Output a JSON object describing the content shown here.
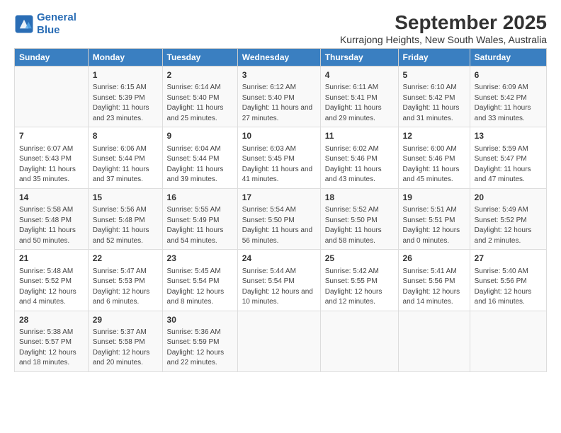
{
  "header": {
    "logo_line1": "General",
    "logo_line2": "Blue",
    "title": "September 2025",
    "subtitle": "Kurrajong Heights, New South Wales, Australia"
  },
  "days_of_week": [
    "Sunday",
    "Monday",
    "Tuesday",
    "Wednesday",
    "Thursday",
    "Friday",
    "Saturday"
  ],
  "weeks": [
    [
      {
        "day": "",
        "sunrise": "",
        "sunset": "",
        "daylight": ""
      },
      {
        "day": "1",
        "sunrise": "Sunrise: 6:15 AM",
        "sunset": "Sunset: 5:39 PM",
        "daylight": "Daylight: 11 hours and 23 minutes."
      },
      {
        "day": "2",
        "sunrise": "Sunrise: 6:14 AM",
        "sunset": "Sunset: 5:40 PM",
        "daylight": "Daylight: 11 hours and 25 minutes."
      },
      {
        "day": "3",
        "sunrise": "Sunrise: 6:12 AM",
        "sunset": "Sunset: 5:40 PM",
        "daylight": "Daylight: 11 hours and 27 minutes."
      },
      {
        "day": "4",
        "sunrise": "Sunrise: 6:11 AM",
        "sunset": "Sunset: 5:41 PM",
        "daylight": "Daylight: 11 hours and 29 minutes."
      },
      {
        "day": "5",
        "sunrise": "Sunrise: 6:10 AM",
        "sunset": "Sunset: 5:42 PM",
        "daylight": "Daylight: 11 hours and 31 minutes."
      },
      {
        "day": "6",
        "sunrise": "Sunrise: 6:09 AM",
        "sunset": "Sunset: 5:42 PM",
        "daylight": "Daylight: 11 hours and 33 minutes."
      }
    ],
    [
      {
        "day": "7",
        "sunrise": "Sunrise: 6:07 AM",
        "sunset": "Sunset: 5:43 PM",
        "daylight": "Daylight: 11 hours and 35 minutes."
      },
      {
        "day": "8",
        "sunrise": "Sunrise: 6:06 AM",
        "sunset": "Sunset: 5:44 PM",
        "daylight": "Daylight: 11 hours and 37 minutes."
      },
      {
        "day": "9",
        "sunrise": "Sunrise: 6:04 AM",
        "sunset": "Sunset: 5:44 PM",
        "daylight": "Daylight: 11 hours and 39 minutes."
      },
      {
        "day": "10",
        "sunrise": "Sunrise: 6:03 AM",
        "sunset": "Sunset: 5:45 PM",
        "daylight": "Daylight: 11 hours and 41 minutes."
      },
      {
        "day": "11",
        "sunrise": "Sunrise: 6:02 AM",
        "sunset": "Sunset: 5:46 PM",
        "daylight": "Daylight: 11 hours and 43 minutes."
      },
      {
        "day": "12",
        "sunrise": "Sunrise: 6:00 AM",
        "sunset": "Sunset: 5:46 PM",
        "daylight": "Daylight: 11 hours and 45 minutes."
      },
      {
        "day": "13",
        "sunrise": "Sunrise: 5:59 AM",
        "sunset": "Sunset: 5:47 PM",
        "daylight": "Daylight: 11 hours and 47 minutes."
      }
    ],
    [
      {
        "day": "14",
        "sunrise": "Sunrise: 5:58 AM",
        "sunset": "Sunset: 5:48 PM",
        "daylight": "Daylight: 11 hours and 50 minutes."
      },
      {
        "day": "15",
        "sunrise": "Sunrise: 5:56 AM",
        "sunset": "Sunset: 5:48 PM",
        "daylight": "Daylight: 11 hours and 52 minutes."
      },
      {
        "day": "16",
        "sunrise": "Sunrise: 5:55 AM",
        "sunset": "Sunset: 5:49 PM",
        "daylight": "Daylight: 11 hours and 54 minutes."
      },
      {
        "day": "17",
        "sunrise": "Sunrise: 5:54 AM",
        "sunset": "Sunset: 5:50 PM",
        "daylight": "Daylight: 11 hours and 56 minutes."
      },
      {
        "day": "18",
        "sunrise": "Sunrise: 5:52 AM",
        "sunset": "Sunset: 5:50 PM",
        "daylight": "Daylight: 11 hours and 58 minutes."
      },
      {
        "day": "19",
        "sunrise": "Sunrise: 5:51 AM",
        "sunset": "Sunset: 5:51 PM",
        "daylight": "Daylight: 12 hours and 0 minutes."
      },
      {
        "day": "20",
        "sunrise": "Sunrise: 5:49 AM",
        "sunset": "Sunset: 5:52 PM",
        "daylight": "Daylight: 12 hours and 2 minutes."
      }
    ],
    [
      {
        "day": "21",
        "sunrise": "Sunrise: 5:48 AM",
        "sunset": "Sunset: 5:52 PM",
        "daylight": "Daylight: 12 hours and 4 minutes."
      },
      {
        "day": "22",
        "sunrise": "Sunrise: 5:47 AM",
        "sunset": "Sunset: 5:53 PM",
        "daylight": "Daylight: 12 hours and 6 minutes."
      },
      {
        "day": "23",
        "sunrise": "Sunrise: 5:45 AM",
        "sunset": "Sunset: 5:54 PM",
        "daylight": "Daylight: 12 hours and 8 minutes."
      },
      {
        "day": "24",
        "sunrise": "Sunrise: 5:44 AM",
        "sunset": "Sunset: 5:54 PM",
        "daylight": "Daylight: 12 hours and 10 minutes."
      },
      {
        "day": "25",
        "sunrise": "Sunrise: 5:42 AM",
        "sunset": "Sunset: 5:55 PM",
        "daylight": "Daylight: 12 hours and 12 minutes."
      },
      {
        "day": "26",
        "sunrise": "Sunrise: 5:41 AM",
        "sunset": "Sunset: 5:56 PM",
        "daylight": "Daylight: 12 hours and 14 minutes."
      },
      {
        "day": "27",
        "sunrise": "Sunrise: 5:40 AM",
        "sunset": "Sunset: 5:56 PM",
        "daylight": "Daylight: 12 hours and 16 minutes."
      }
    ],
    [
      {
        "day": "28",
        "sunrise": "Sunrise: 5:38 AM",
        "sunset": "Sunset: 5:57 PM",
        "daylight": "Daylight: 12 hours and 18 minutes."
      },
      {
        "day": "29",
        "sunrise": "Sunrise: 5:37 AM",
        "sunset": "Sunset: 5:58 PM",
        "daylight": "Daylight: 12 hours and 20 minutes."
      },
      {
        "day": "30",
        "sunrise": "Sunrise: 5:36 AM",
        "sunset": "Sunset: 5:59 PM",
        "daylight": "Daylight: 12 hours and 22 minutes."
      },
      {
        "day": "",
        "sunrise": "",
        "sunset": "",
        "daylight": ""
      },
      {
        "day": "",
        "sunrise": "",
        "sunset": "",
        "daylight": ""
      },
      {
        "day": "",
        "sunrise": "",
        "sunset": "",
        "daylight": ""
      },
      {
        "day": "",
        "sunrise": "",
        "sunset": "",
        "daylight": ""
      }
    ]
  ]
}
